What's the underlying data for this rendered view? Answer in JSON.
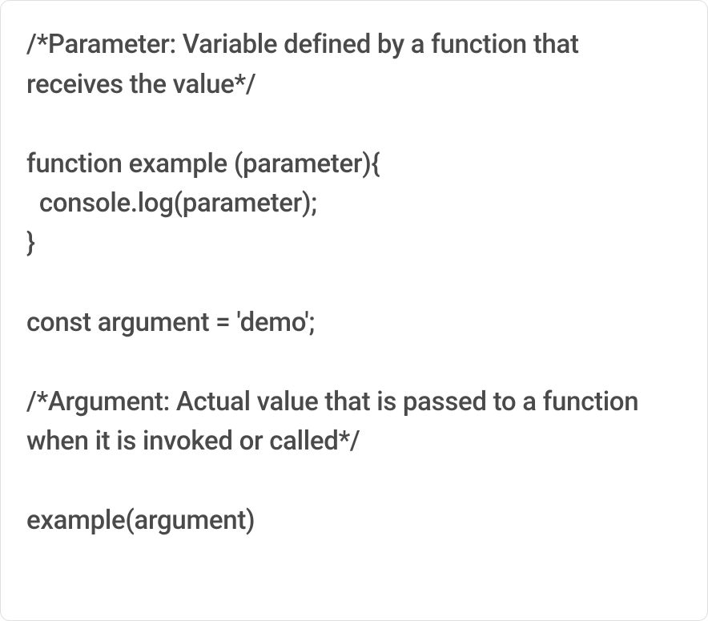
{
  "code": {
    "line1": "/*Parameter: Variable defined by a function that receives the value*/",
    "line2": "",
    "line3": "function example (parameter){",
    "line4": "  console.log(parameter);",
    "line5": "}",
    "line6": "",
    "line7": "const argument = 'demo';",
    "line8": "",
    "line9": "/*Argument: Actual value that is passed to a function when it is invoked or called*/",
    "line10": "",
    "line11": "example(argument)"
  }
}
